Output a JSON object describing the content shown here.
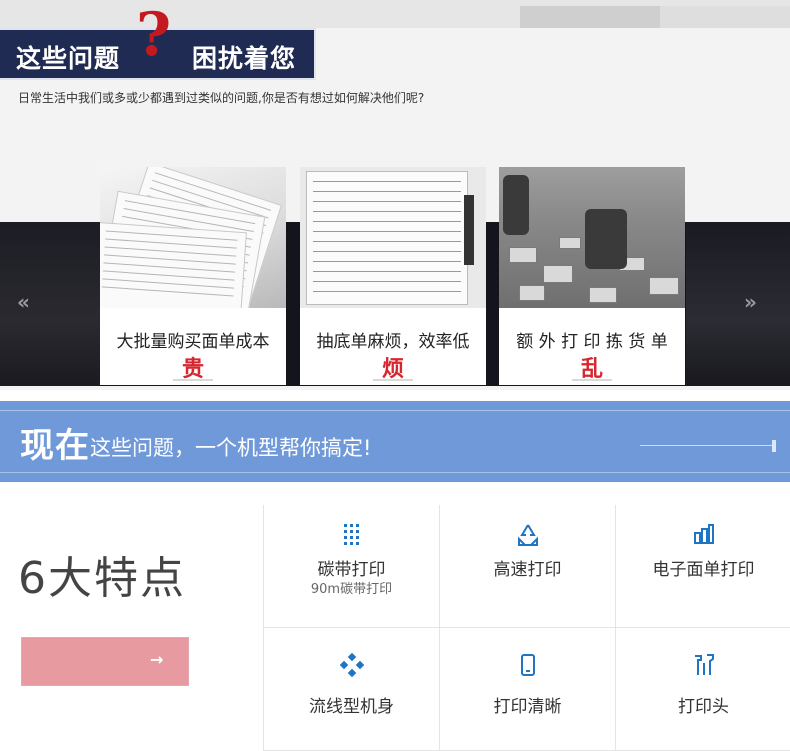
{
  "header": {
    "title_left": "这些问题",
    "question_mark": "?",
    "title_right": "困扰着您",
    "intro": "日常生活中我们或多或少都遇到过类似的问题,你是否有想过如何解决他们呢?"
  },
  "nav": {
    "prev": "«",
    "next": "»"
  },
  "problems": [
    {
      "caption": "大批量购买面单成本",
      "word": "贵"
    },
    {
      "caption": "抽底单麻烦，效率低",
      "word": "烦"
    },
    {
      "caption": "额 外 打 印 拣 货 单",
      "word": "乱"
    }
  ],
  "banner": {
    "lead": "现在",
    "rest": "这些问题，一个机型帮你搞定!"
  },
  "features": {
    "title": "6大特点",
    "button_arrow": "→",
    "items": [
      {
        "label": "碳带打印",
        "sub": "90m碳带打印",
        "icon": "ribbon-icon"
      },
      {
        "label": "高速打印",
        "sub": "",
        "icon": "recycle-icon"
      },
      {
        "label": "电子面单打印",
        "sub": "",
        "icon": "bar-chart-icon"
      },
      {
        "label": "流线型机身",
        "sub": "",
        "icon": "diamond-dots-icon"
      },
      {
        "label": "打印清晰",
        "sub": "",
        "icon": "phone-icon"
      },
      {
        "label": "打印头",
        "sub": "",
        "icon": "tools-icon"
      }
    ]
  },
  "colors": {
    "title_bg": "#1f2b52",
    "accent_red": "#d8262f",
    "banner_blue": "#6f99d8",
    "icon_blue": "#1f74c4",
    "button_pink": "#e89aa1"
  }
}
